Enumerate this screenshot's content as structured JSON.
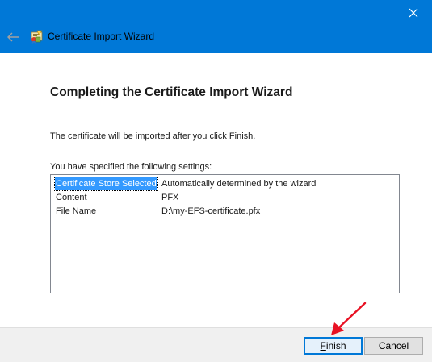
{
  "window": {
    "title": "Certificate Import Wizard",
    "icons": {
      "close": "close-icon",
      "back": "back-arrow-icon",
      "app": "certificate-icon"
    }
  },
  "page": {
    "heading": "Completing the Certificate Import Wizard",
    "description": "The certificate will be imported after you click Finish.",
    "settings_label": "You have specified the following settings:",
    "settings": [
      {
        "key": "Certificate Store Selected",
        "value": "Automatically determined by the wizard"
      },
      {
        "key": "Content",
        "value": "PFX"
      },
      {
        "key": "File Name",
        "value": "D:\\my-EFS-certificate.pfx"
      }
    ]
  },
  "footer": {
    "finish_label": "Finish",
    "finish_access_key": "F",
    "cancel_label": "Cancel"
  },
  "colors": {
    "titlebar": "#0078d7",
    "selection": "#3399ff",
    "annotation_arrow": "#e81123"
  }
}
